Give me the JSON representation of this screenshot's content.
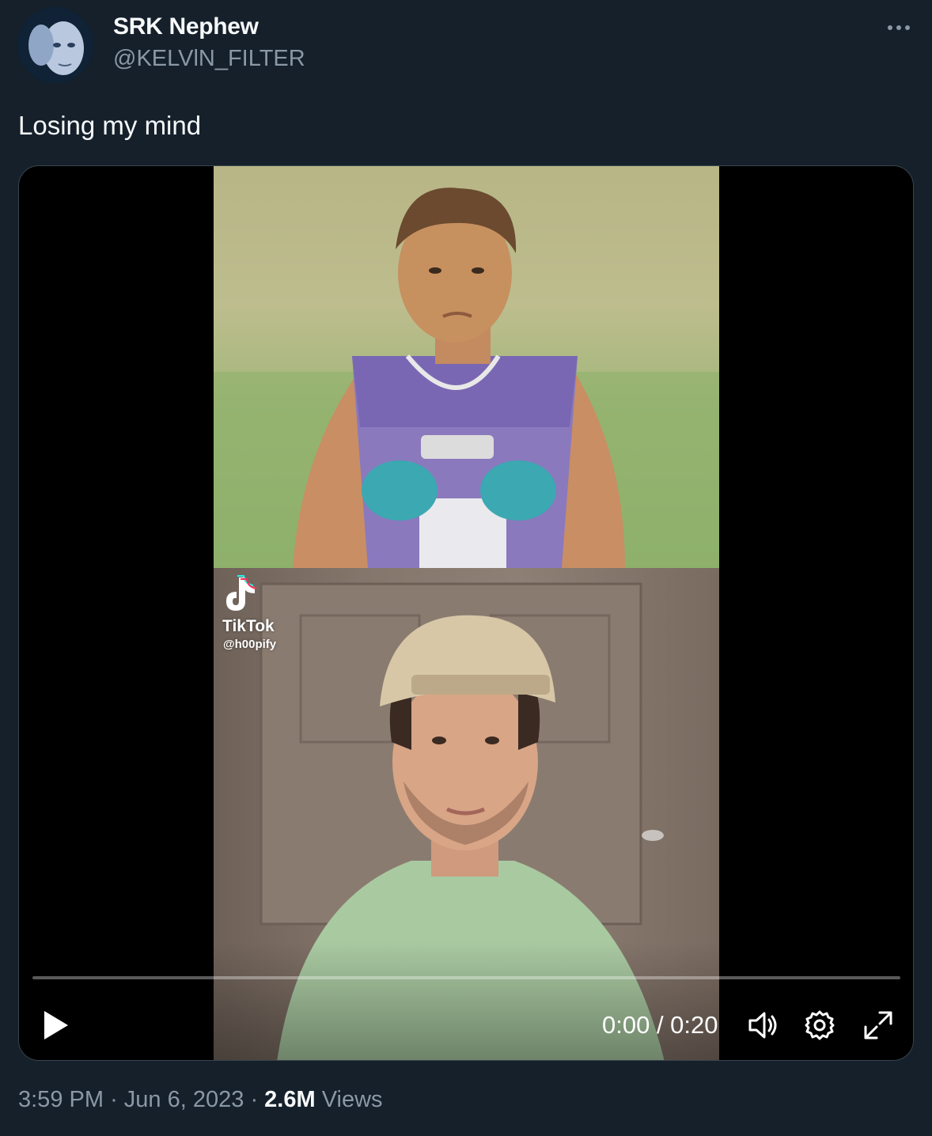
{
  "author": {
    "display_name": "SRK Nephew",
    "handle": "@KELVlN_FILTER",
    "avatar_icon": "avatar-image"
  },
  "tweet": {
    "text": "Losing my mind"
  },
  "video": {
    "watermark_brand": "TikTok",
    "watermark_user": "@h00pify",
    "time": "0:00 / 0:20",
    "progress": 0,
    "controls": {
      "play_icon": "play-icon",
      "volume_icon": "volume-icon",
      "settings_icon": "gear-icon",
      "fullscreen_icon": "fullscreen-icon"
    }
  },
  "footer": {
    "time": "3:59 PM",
    "separator_1": "·",
    "date": "Jun 6, 2023",
    "separator_2": "·",
    "views_count": "2.6M",
    "views_label": "Views"
  },
  "colors": {
    "background": "#15202b",
    "primary_text": "#f7f9f9",
    "secondary_text": "#8b98a5",
    "border": "#38444d"
  }
}
